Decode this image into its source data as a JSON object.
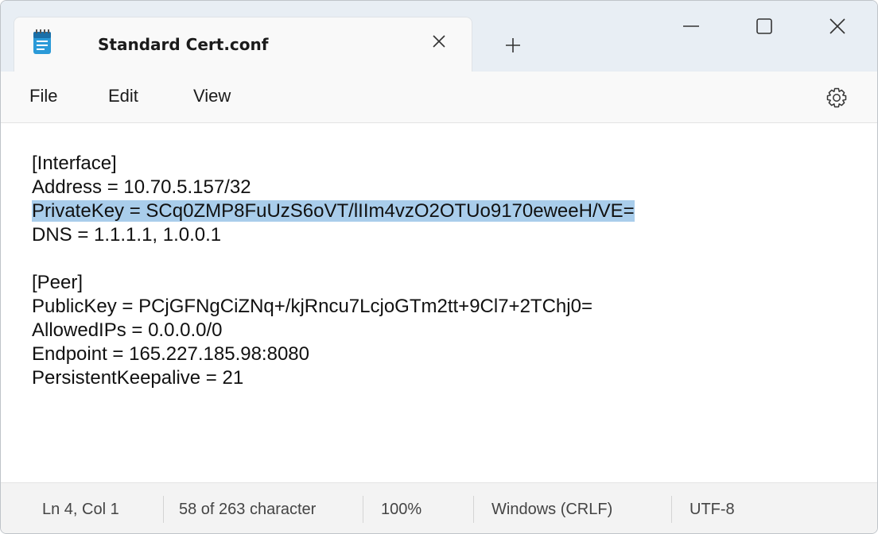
{
  "tab": {
    "title": "Standard Cert.conf"
  },
  "menu": {
    "file": "File",
    "edit": "Edit",
    "view": "View"
  },
  "editor": {
    "lines": [
      "[Interface]",
      "Address = 10.70.5.157/32",
      "PrivateKey = SCq0ZMP8FuUzS6oVT/lIIm4vzO2OTUo9170eweeH/VE=",
      "DNS = 1.1.1.1, 1.0.0.1",
      "",
      "[Peer]",
      "PublicKey = PCjGFNgCiZNq+/kjRncu7LcjoGTm2tt+9Cl7+2TChj0=",
      "AllowedIPs = 0.0.0.0/0",
      "Endpoint = 165.227.185.98:8080",
      "PersistentKeepalive = 21"
    ],
    "selected_line_index": 2
  },
  "status": {
    "position": "Ln 4, Col 1",
    "characters": "58 of 263 character",
    "zoom": "100%",
    "line_ending": "Windows (CRLF)",
    "encoding": "UTF-8"
  },
  "icons": {
    "app": "notepad-icon",
    "tab_close": "close-icon",
    "new_tab": "plus-icon",
    "minimize": "minimize-icon",
    "maximize": "maximize-icon",
    "close": "close-icon",
    "settings": "gear-icon"
  },
  "colors": {
    "selection": "#a9cdeb",
    "titlebar": "#e8eef4",
    "notepad_blue": "#1f8fd6"
  }
}
